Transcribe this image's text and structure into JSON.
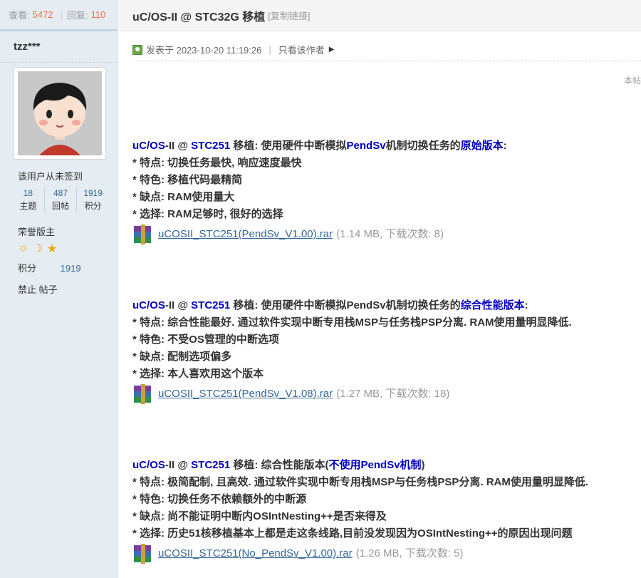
{
  "sidebar": {
    "views_label": "查看:",
    "views": "5472",
    "replies_label": "回复:",
    "replies": "110",
    "author": "tzz***",
    "signin_text": "该用户从未签到",
    "stats": [
      {
        "value": "18",
        "label": "主题"
      },
      {
        "value": "487",
        "label": "回帖"
      },
      {
        "value": "1919",
        "label": "积分"
      }
    ],
    "rank": "荣誉版主",
    "points_label": "积分",
    "points_value": "1919",
    "banned_text": "禁止 帖子"
  },
  "header": {
    "title": "uC/OS-II @ STC32G 移植",
    "copy_link": "[复制链接]"
  },
  "post_meta": {
    "posted": "发表于 2023-10-20 11:19:26",
    "only_author": "只看该作者"
  },
  "side_note": "本帖",
  "blocks": [
    {
      "h_prefix": "uC/",
      "h_os": "OS",
      "h_mid": "-II @ ",
      "h_chip": "STC251",
      "h_text": " 移植: 使用硬件中断模拟",
      "h_pendsv": "PendSv",
      "h_text2": "机制切换任务的",
      "h_ver": "原始版本",
      "h_end": ":",
      "lines": [
        "* 特点: 切换任务最快, 响应速度最快",
        "* 特色: 移植代码最精简",
        "* 缺点: RAM使用量大",
        "* 选择: RAM足够时, 很好的选择"
      ],
      "file": "uCOSII_STC251(PendSv_V1.00).rar",
      "info": "(1.14 MB, 下载次数: 8)"
    },
    {
      "h_prefix": "uC/",
      "h_os": "OS",
      "h_mid": "-II @ ",
      "h_chip": "STC251",
      "h_text": " 移植: 使用硬件中断模拟",
      "h_pendsv": "PendSv",
      "h_text2": "机制切换任务的",
      "h_ver": "综合性能版本",
      "h_end": ":",
      "lines": [
        "* 特点: 综合性能最好.  通过软件实现中断专用栈MSP与任务栈PSP分离. RAM使用量明显降低.",
        "* 特色: 不受OS管理的中断选项",
        "* 缺点: 配制选项偏多",
        "* 选择: 本人喜欢用这个版本"
      ],
      "file": "uCOSII_STC251(PendSv_V1.08).rar",
      "info": "(1.27 MB, 下载次数: 18)"
    },
    {
      "h_prefix": "uC/",
      "h_os": "OS",
      "h_mid": "-II @ ",
      "h_chip": "STC251",
      "h_text": " 移植: 综合性能版本(",
      "h_pendsv": "",
      "h_text2": "",
      "h_ver": "不使用PendSv机制",
      "h_end": ")",
      "lines": [
        "* 特点: 极简配制, 且高效. 通过软件实现中断专用栈MSP与任务栈PSP分离. RAM使用量明显降低.",
        "* 特色: 切换任务不依赖额外的中断源",
        "* 缺点: 尚不能证明中断内OSIntNesting++是否来得及",
        "* 选择: 历史51核移植基本上都是走这条线路,目前没发现因为OSIntNesting++的原因出现问题"
      ],
      "file": "uCOSII_STC251(No_PendSv_V1.00).rar",
      "info": "(1.26 MB, 下载次数: 5)"
    }
  ]
}
